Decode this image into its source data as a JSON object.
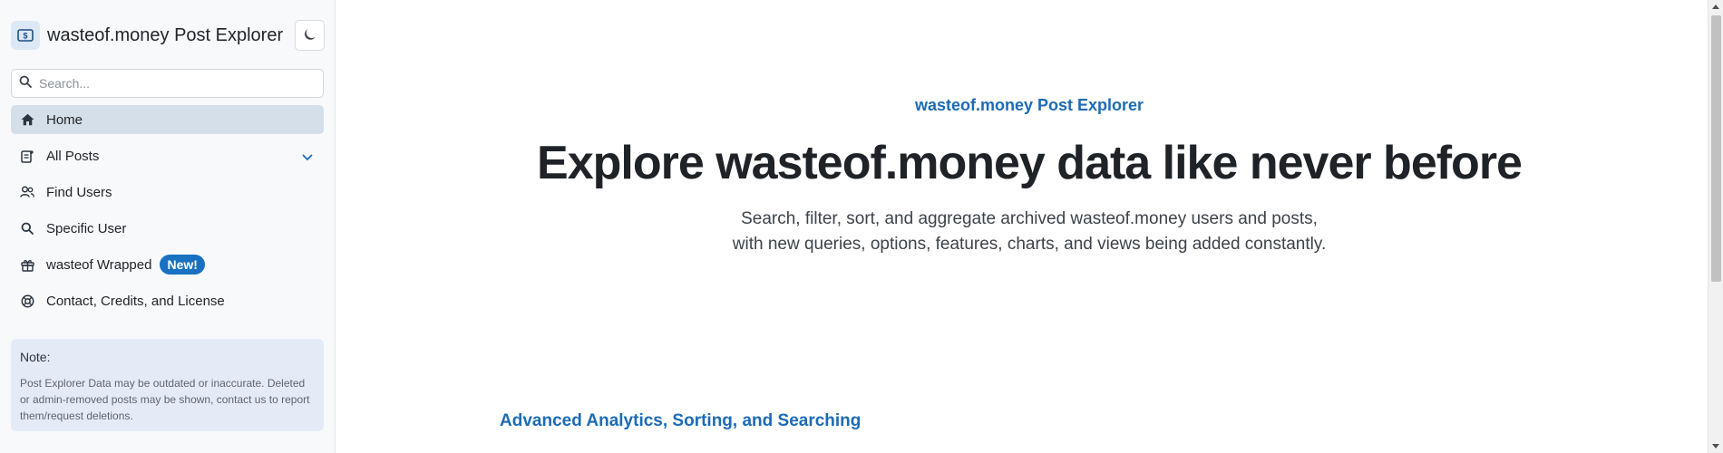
{
  "sidebar": {
    "brand_title": "wasteof.money Post Explorer",
    "brand_icon": "money-icon",
    "theme_toggle_icon": "moon-icon",
    "search": {
      "placeholder": "Search...",
      "value": ""
    },
    "items": [
      {
        "label": "Home",
        "icon": "home-icon",
        "active": true
      },
      {
        "label": "All Posts",
        "icon": "posts-icon",
        "expandable": true
      },
      {
        "label": "Find Users",
        "icon": "users-icon"
      },
      {
        "label": "Specific User",
        "icon": "search-icon"
      },
      {
        "label": "wasteof Wrapped",
        "icon": "gift-icon",
        "badge": "New!"
      },
      {
        "label": "Contact, Credits, and License",
        "icon": "lifebuoy-icon"
      }
    ],
    "note": {
      "title": "Note:",
      "text": "Post Explorer Data may be outdated or inaccurate. Deleted or admin-removed posts may be shown, contact us to report them/request deletions."
    }
  },
  "main": {
    "eyebrow": "wasteof.money Post Explorer",
    "headline": "Explore wasteof.money data like never before",
    "subtitle_line1": "Search, filter, sort, and aggregate archived wasteof.money users and posts,",
    "subtitle_line2": "with new queries, options, features, charts, and views being added constantly.",
    "section_title": "Advanced Analytics, Sorting, and Searching"
  },
  "colors": {
    "accent": "#1c6bb5",
    "badge": "#1971c2",
    "sidebar_bg": "#f8f9fb",
    "active_item_bg": "#d5dfe9",
    "note_bg": "#e3ecf6"
  }
}
